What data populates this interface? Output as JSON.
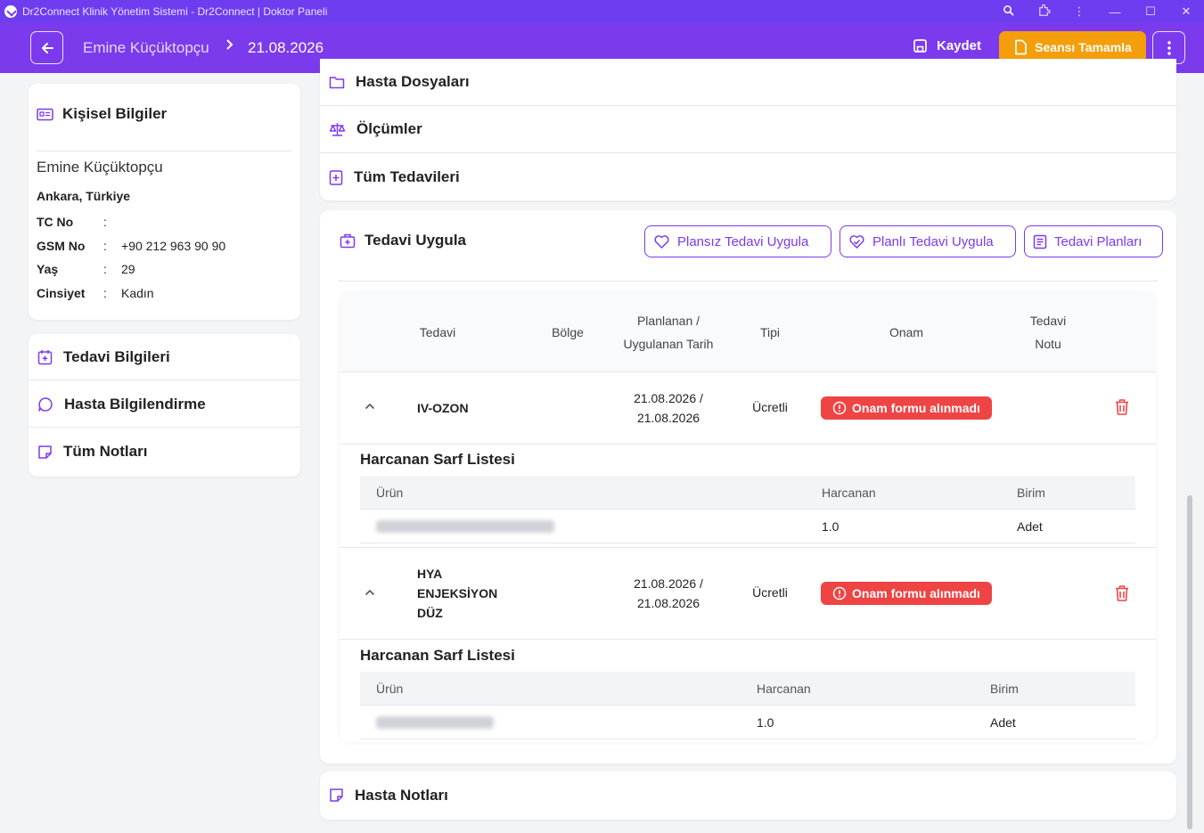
{
  "window": {
    "title": "Dr2Connect Klinik Yönetim Sistemi - Dr2Connect | Doktor Paneli"
  },
  "header": {
    "patient": "Emine Küçüktopçu",
    "date": "21.08.2026",
    "save_label": "Kaydet",
    "complete_label": "Seansı Tamamla"
  },
  "personal": {
    "title": "Kişisel Bilgiler",
    "name": "Emine Küçüktopçu",
    "location": "Ankara, Türkiye",
    "rows": [
      {
        "key": "TC No",
        "value": ""
      },
      {
        "key": "GSM No",
        "value": "+90 212 963 90 90"
      },
      {
        "key": "Yaş",
        "value": "29"
      },
      {
        "key": "Cinsiyet",
        "value": "Kadın"
      }
    ]
  },
  "left_nav": [
    {
      "label": "Tedavi Bilgileri",
      "icon": "calendar-plus-icon"
    },
    {
      "label": "Hasta Bilgilendirme",
      "icon": "chat-bubble-icon"
    },
    {
      "label": "Tüm Notları",
      "icon": "sticky-note-icon"
    }
  ],
  "accordion": [
    {
      "label": "Hasta Dosyaları",
      "icon": "folder-icon"
    },
    {
      "label": "Ölçümler",
      "icon": "scale-icon"
    },
    {
      "label": "Tüm Tedavileri",
      "icon": "medical-plus-icon"
    }
  ],
  "treatment": {
    "title": "Tedavi Uygula",
    "buttons": [
      "Plansız Tedavi Uygula",
      "Planlı Tedavi Uygula",
      "Tedavi Planları"
    ],
    "columns": {
      "tedavi": "Tedavi",
      "bolge": "Bölge",
      "planned_1": "Planlanan /",
      "planned_2": "Uygulanan Tarih",
      "tipi": "Tipi",
      "onam": "Onam",
      "note_1": "Tedavi",
      "note_2": "Notu"
    },
    "rows": [
      {
        "name_lines": [
          "IV-OZON"
        ],
        "date_lines": [
          "21.08.2026 /",
          "21.08.2026"
        ],
        "type": "Ücretli",
        "consent": "Onam formu alınmadı",
        "sarf_title": "Harcanan Sarf Listesi",
        "sarf_head": {
          "urun": "Ürün",
          "harcanan": "Harcanan",
          "birim": "Birim"
        },
        "sarf_items": [
          {
            "harcanan": "1.0",
            "birim": "Adet"
          }
        ]
      },
      {
        "name_lines": [
          "HYA",
          "ENJEKSİYON",
          "DÜZ"
        ],
        "date_lines": [
          "21.08.2026 /",
          "21.08.2026"
        ],
        "type": "Ücretli",
        "consent": "Onam formu alınmadı",
        "sarf_title": "Harcanan Sarf Listesi",
        "sarf_head": {
          "urun": "Ürün",
          "harcanan": "Harcanan",
          "birim": "Birim"
        },
        "sarf_items": [
          {
            "harcanan": "1.0",
            "birim": "Adet"
          }
        ]
      }
    ]
  },
  "notes": {
    "title": "Hasta Notları"
  },
  "colors": {
    "primary": "#7c3aed",
    "accent": "#f59e0b",
    "danger": "#ef4444"
  }
}
